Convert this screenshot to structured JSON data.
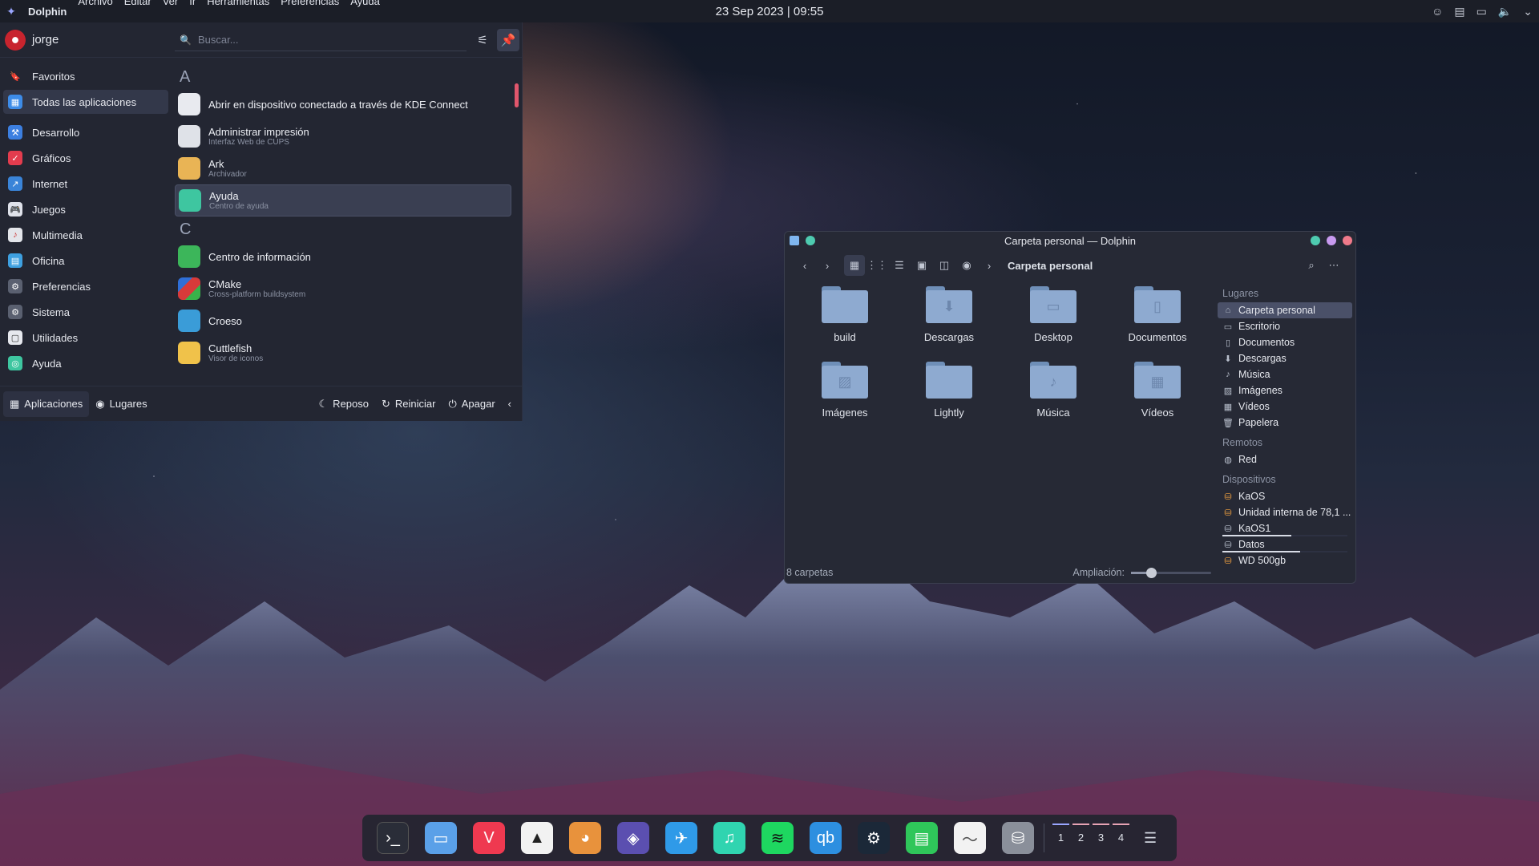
{
  "topbar": {
    "app": "Dolphin",
    "menu": [
      "Archivo",
      "Editar",
      "Ver",
      "Ir",
      "Herramientas",
      "Preferencias",
      "Ayuda"
    ],
    "clock": "23 Sep 2023 | 09:55"
  },
  "launcher": {
    "user": "jorge",
    "search_placeholder": "Buscar...",
    "categories": [
      {
        "label": "Favoritos",
        "icon": "bookmark-icon"
      },
      {
        "label": "Todas las aplicaciones",
        "icon": "grid-icon"
      },
      {
        "label": "Desarrollo",
        "icon": "development-icon"
      },
      {
        "label": "Gráficos",
        "icon": "graphics-icon"
      },
      {
        "label": "Internet",
        "icon": "internet-icon"
      },
      {
        "label": "Juegos",
        "icon": "games-icon"
      },
      {
        "label": "Multimedia",
        "icon": "multimedia-icon"
      },
      {
        "label": "Oficina",
        "icon": "office-icon"
      },
      {
        "label": "Preferencias",
        "icon": "preferences-icon"
      },
      {
        "label": "Sistema",
        "icon": "system-icon"
      },
      {
        "label": "Utilidades",
        "icon": "utilities-icon"
      },
      {
        "label": "Ayuda",
        "icon": "help-icon"
      }
    ],
    "letters": [
      "A",
      "C"
    ],
    "apps_a": [
      {
        "name": "Abrir en dispositivo conectado a través de KDE Connect",
        "sub": ""
      },
      {
        "name": "Administrar impresión",
        "sub": "Interfaz Web de CUPS"
      },
      {
        "name": "Ark",
        "sub": "Archivador"
      },
      {
        "name": "Ayuda",
        "sub": "Centro de ayuda"
      }
    ],
    "apps_c": [
      {
        "name": "Centro de información",
        "sub": ""
      },
      {
        "name": "CMake",
        "sub": "Cross-platform buildsystem"
      },
      {
        "name": "Croeso",
        "sub": ""
      },
      {
        "name": "Cuttlefish",
        "sub": "Visor de iconos"
      }
    ],
    "footer": {
      "apps": "Aplicaciones",
      "places": "Lugares",
      "sleep": "Reposo",
      "restart": "Reiniciar",
      "shutdown": "Apagar"
    }
  },
  "dolphin": {
    "title": "Carpeta personal — Dolphin",
    "breadcrumb": "Carpeta personal",
    "folders": [
      "build",
      "Descargas",
      "Desktop",
      "Documentos",
      "Imágenes",
      "Lightly",
      "Música",
      "Vídeos"
    ],
    "status": "8 carpetas",
    "zoom_label": "Ampliación:",
    "zoom_fraction": 0.25,
    "places_heading": "Lugares",
    "places": [
      "Carpeta personal",
      "Escritorio",
      "Documentos",
      "Descargas",
      "Música",
      "Imágenes",
      "Vídeos",
      "Papelera"
    ],
    "remote_heading": "Remotos",
    "remote": [
      "Red"
    ],
    "devices_heading": "Dispositivos",
    "devices": [
      "KaOS",
      "Unidad interna de 78,1 ...",
      "KaOS1",
      "Datos",
      "WD 500gb"
    ],
    "device_usage": [
      0,
      0,
      0.55,
      0.62,
      0
    ]
  },
  "dock": {
    "desktops": [
      "1",
      "2",
      "3",
      "4"
    ]
  },
  "colors": {
    "accent": "#9aa6ff",
    "scroll": "#e0566c",
    "folder": "#8eaad0"
  }
}
